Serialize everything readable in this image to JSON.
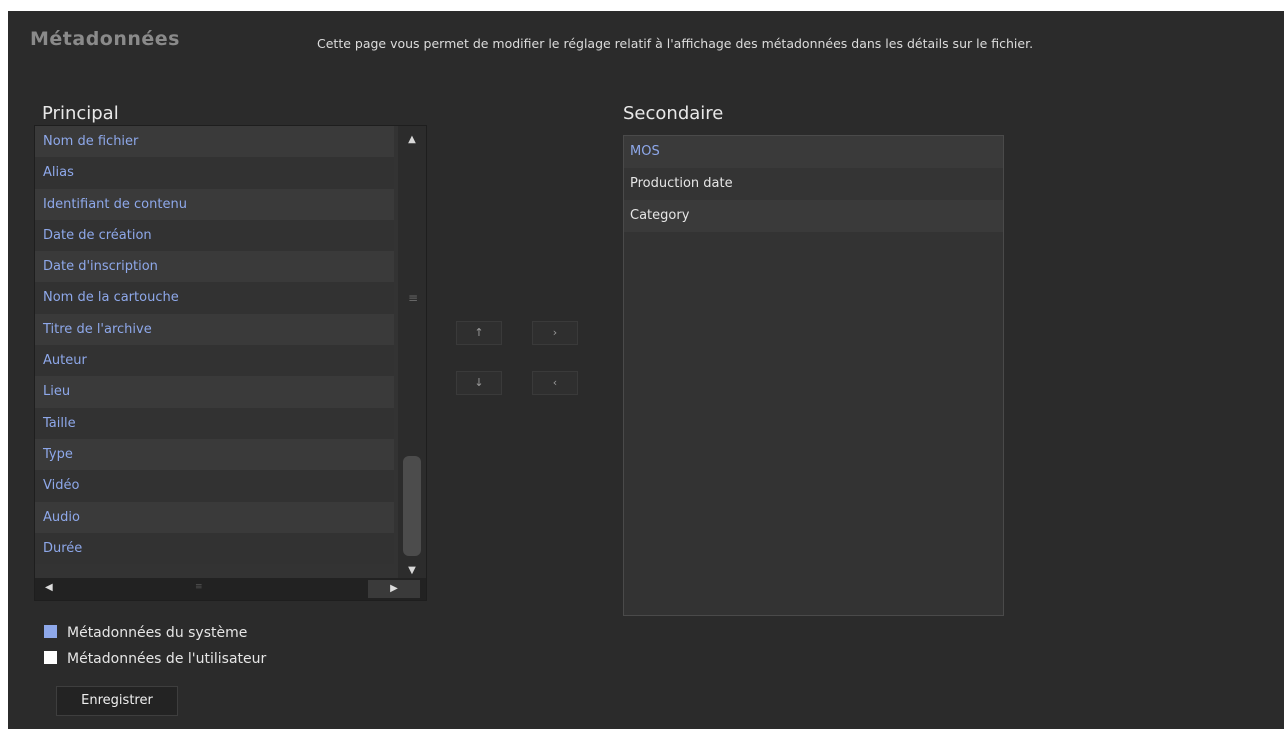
{
  "header": {
    "title": "Métadonnées",
    "description": "Cette page vous permet de modifier le réglage relatif à l'affichage des métadonnées dans les détails sur le fichier."
  },
  "primary": {
    "label": "Principal",
    "items": [
      "Nom de fichier",
      "Alias",
      "Identifiant de contenu",
      "Date de création",
      "Date d'inscription",
      "Nom de la cartouche",
      "Titre de l'archive",
      "Auteur",
      "Lieu",
      "Taille",
      "Type",
      "Vidéo",
      "Audio",
      "Durée"
    ]
  },
  "secondary": {
    "label": "Secondaire",
    "items": [
      "MOS",
      "Production date",
      "Category"
    ]
  },
  "legend": {
    "system": "Métadonnées du système",
    "user": "Métadonnées de l'utilisateur",
    "system_color": "#8ea8ea",
    "user_color": "#ffffff"
  },
  "icons": {
    "up_arrow": "▲",
    "down_arrow": "▼",
    "left_arrow": "◀",
    "right_arrow": "▶",
    "move_up": "↑",
    "move_down": "↓",
    "move_right": "›",
    "move_left": "‹",
    "grip": "≡"
  },
  "buttons": {
    "save": "Enregistrer"
  }
}
